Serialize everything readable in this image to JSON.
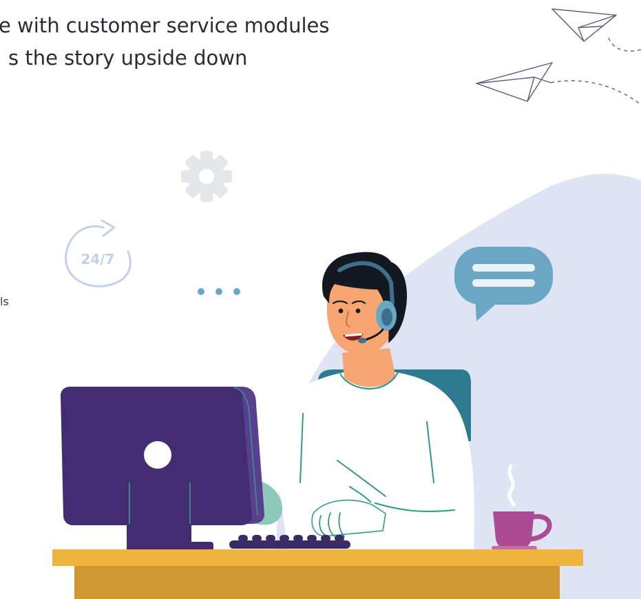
{
  "headline": {
    "line1": "e with customer service modules",
    "line2": "s the story upside down"
  },
  "side_text": "ls",
  "badge": {
    "label": "24/7"
  },
  "colors": {
    "blob": "#dfe4f4",
    "monitor": "#432c72",
    "desk_top": "#f0b43c",
    "desk_body": "#cf9832",
    "chair": "#2e7a91",
    "shirt": "#ffffff",
    "shirt_lines": "#2e9988",
    "skin": "#f7a672",
    "hair": "#141820",
    "headset": "#3d6f8f",
    "cup": "#ad4a94",
    "chat_blue": "#6ba7c4",
    "gear": "#e4e6ec",
    "plane_lines": "#5e587a"
  },
  "icons": [
    "paper-plane-icon",
    "gear-icon",
    "24-7-clock-icon",
    "typing-bubble-icon",
    "message-bubble-icon",
    "coffee-cup-icon"
  ]
}
